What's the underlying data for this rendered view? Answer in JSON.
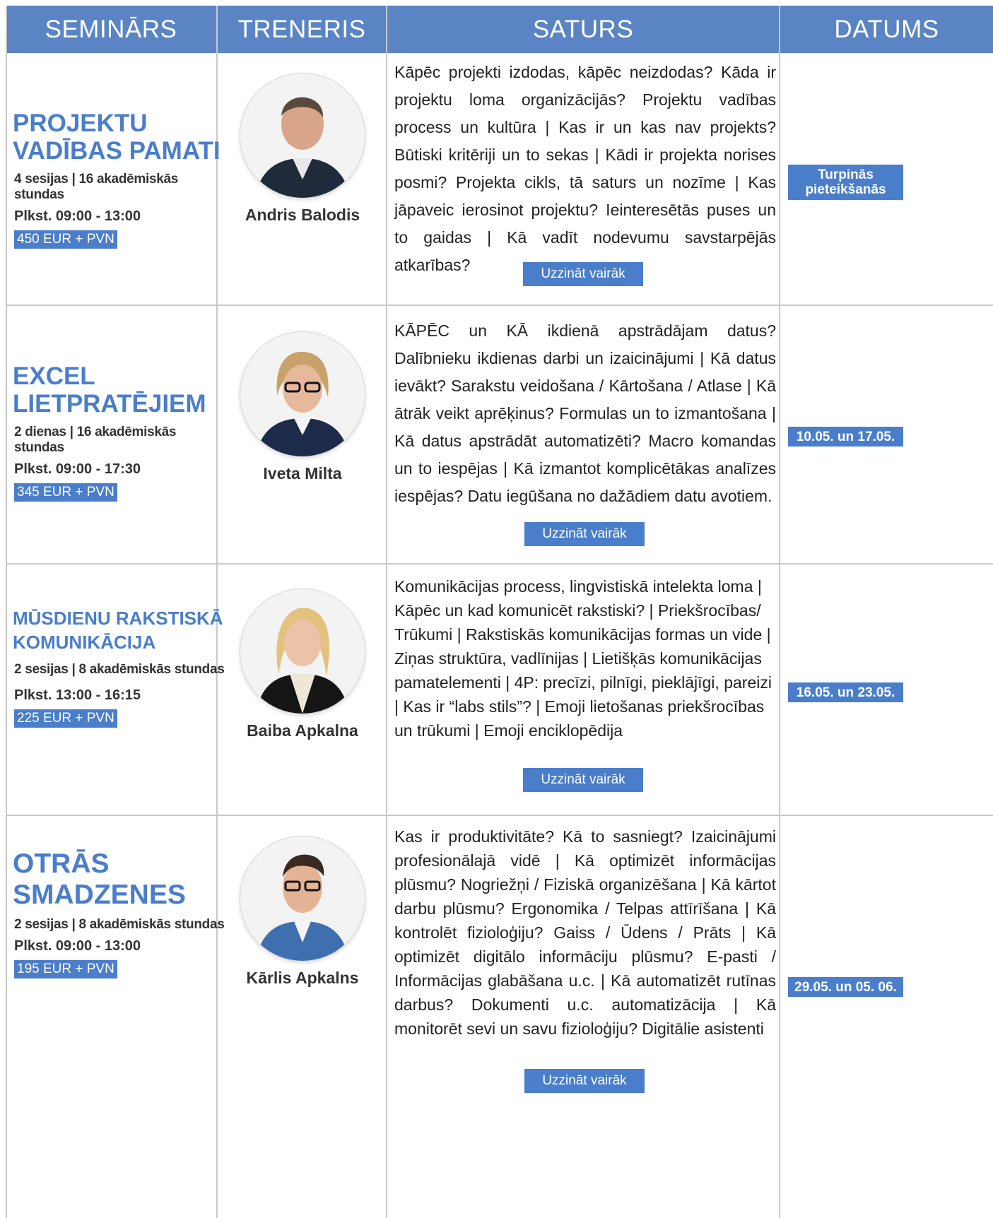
{
  "header": {
    "col1": "SEMINĀRS",
    "col2": "TRENERIS",
    "col3": "SATURS",
    "col4": "DATUMS"
  },
  "rows": [
    {
      "title_lines": [
        "PROJEKTU",
        "VADĪBAS PAMATI"
      ],
      "meta": "4 sesijas | 16 akadēmiskās stundas",
      "time": "Plkst. 09:00 - 13:00",
      "price": "450 EUR + PVN",
      "trainer": "Andris Balodis",
      "content": "Kāpēc projekti izdodas, kāpēc neizdodas? Kāda ir projektu loma organizācijās? Projektu vadības process un kultūra | Kas ir un kas nav projekts? Būtiski kritēriji un to sekas | Kādi ir projekta norises posmi? Projekta cikls, tā saturs un nozīme | Kas jāpaveic ierosinot projektu? Ieinteresētās puses un to gaidas | Kā vadīt nodevumu savstarpējās atkarības?",
      "button": "Uzzināt vairāk",
      "date_lines": [
        "Turpinās",
        "pieteikšanās"
      ]
    },
    {
      "title_lines": [
        "EXCEL",
        "LIETPRATĒJIEM"
      ],
      "meta": "2 dienas | 16 akadēmiskās stundas",
      "time": "Plkst. 09:00 - 17:30",
      "price": "345 EUR + PVN",
      "trainer": "Iveta Milta",
      "content": "KĀPĒC un KĀ ikdienā apstrādājam datus? Dalībnieku ikdienas darbi un izaicinājumi | Kā datus ievākt? Sarakstu veidošana / Kārtošana / Atlase | Kā ātrāk veikt aprēķinus? Formulas un to izmantošana | Kā datus apstrādāt automatizēti? Macro komandas un to iespējas | Kā izmantot komplicētākas analīzes iespējas? Datu iegūšana no dažādiem datu avotiem.",
      "button": "Uzzināt vairāk",
      "date_lines": [
        "10.05. un 17.05."
      ]
    },
    {
      "title_lines": [
        "MŪSDIENU RAKSTISKĀ",
        "KOMUNIKĀCIJA"
      ],
      "meta": "2 sesijas | 8 akadēmiskās stundas",
      "time": "Plkst. 13:00 - 16:15",
      "price": "225 EUR + PVN",
      "trainer": "Baiba Apkalna",
      "content": "Komunikācijas process, lingvistiskā intelekta loma | Kāpēc un kad komunicēt rakstiski? | Priekšrocības/ Trūkumi | Rakstiskās komunikācijas formas un vide | Ziņas struktūra, vadlīnijas | Lietišķās komunikācijas pamatelementi | 4P: precīzi, pilnīgi, pieklājīgi, pareizi | Kas ir “labs stils”? | Emoji lietošanas priekšrocības un trūkumi | Emoji enciklopēdija",
      "button": "Uzzināt vairāk",
      "date_lines": [
        "16.05. un 23.05."
      ]
    },
    {
      "title_lines": [
        "OTRĀS",
        "SMADZENES"
      ],
      "meta": "2 sesijas | 8 akadēmiskās stundas",
      "time": "Plkst. 09:00 - 13:00",
      "price": "195 EUR + PVN",
      "trainer": "Kārlis Apkalns",
      "content": "Kas ir produktivitāte? Kā to sasniegt? Izaicinājumi profesionālajā vidē | Kā optimizēt informācijas plūsmu? Nogriežņi / Fiziskā organizēšana | Kā kārtot darbu plūsmu? Ergonomika / Telpas attīrīšana | Kā kontrolēt fizioloģiju? Gaiss / Ūdens / Prāts | Kā optimizēt digitālo informāciju plūsmu? E-pasti / Informācijas glabāšana u.c. | Kā automatizēt rutīnas darbus? Dokumenti u.c. automatizācija | Kā monitorēt sevi un savu fizioloģiju? Digitālie asistenti",
      "button": "Uzzināt vairāk",
      "date_lines": [
        "29.05. un 05. 06."
      ]
    }
  ]
}
